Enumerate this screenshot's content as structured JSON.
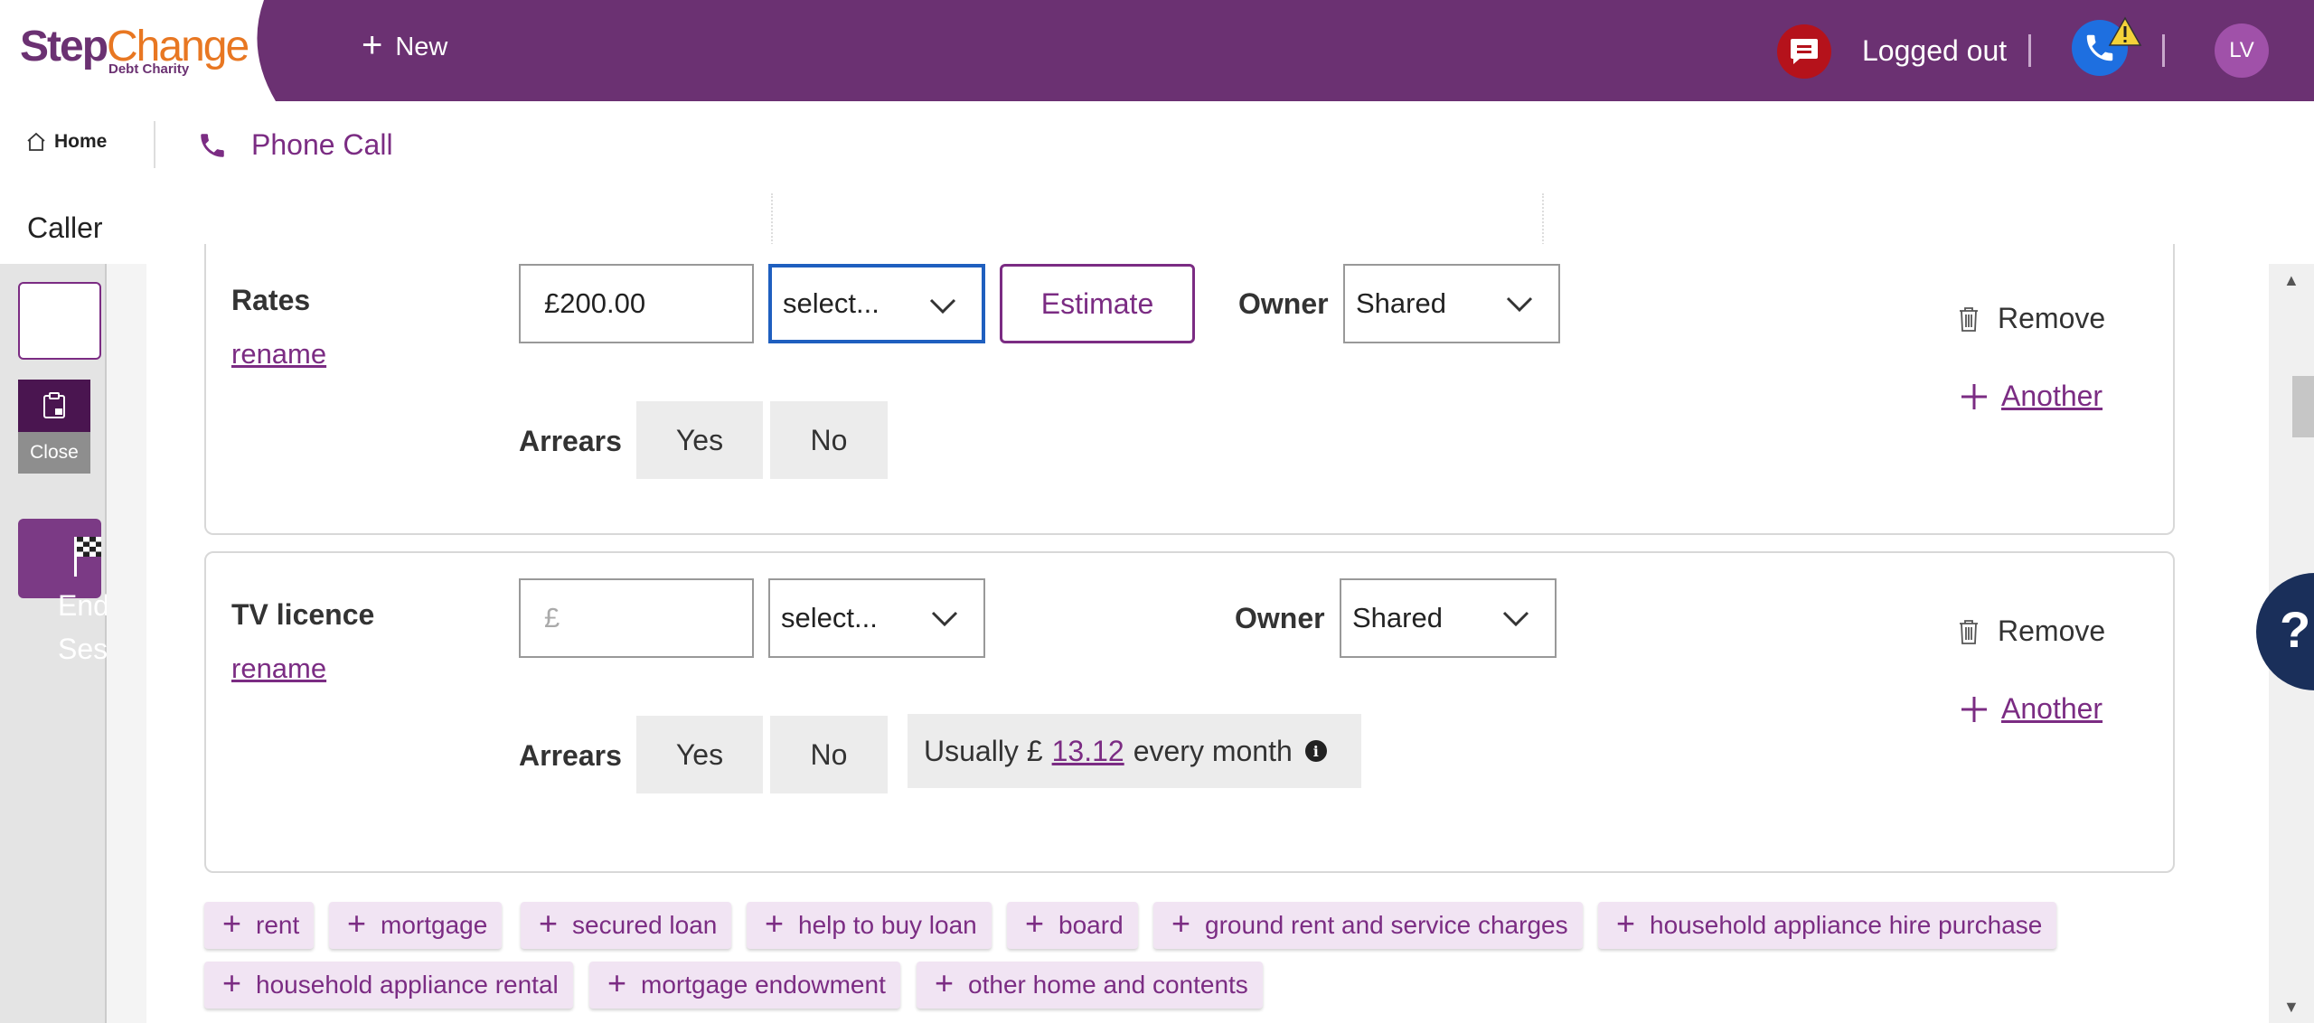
{
  "header": {
    "logo_step": "Step",
    "logo_change": "Change",
    "logo_sub": "Debt Charity",
    "new_label": "New",
    "status": "Logged out",
    "avatar_initials": "LV"
  },
  "nav": {
    "home": "Home",
    "phone_call": "Phone Call",
    "caller": "Caller"
  },
  "rail": {
    "close_label": "Close",
    "end_label": "End Ses"
  },
  "expenses": [
    {
      "name": "Rates",
      "rename": "rename",
      "amount_value": "£200.00",
      "frequency": "select...",
      "estimate_label": "Estimate",
      "owner_label": "Owner",
      "owner_value": "Shared",
      "arrears_label": "Arrears",
      "yes": "Yes",
      "no": "No",
      "remove": "Remove",
      "another": "Another"
    },
    {
      "name": "TV licence",
      "rename": "rename",
      "amount_placeholder": "£",
      "frequency": "select...",
      "owner_label": "Owner",
      "owner_value": "Shared",
      "arrears_label": "Arrears",
      "yes": "Yes",
      "no": "No",
      "remove": "Remove",
      "another": "Another",
      "usually_prefix": "Usually £",
      "usually_amount": "13.12",
      "usually_suffix": "every month"
    }
  ],
  "chips": [
    "rent",
    "mortgage",
    "secured loan",
    "help to buy loan",
    "board",
    "ground rent and service charges",
    "household appliance hire purchase",
    "household appliance rental",
    "mortgage endowment",
    "other home and contents"
  ],
  "help_label": "?",
  "colors": {
    "brand_purple": "#6b3172",
    "accent_purple": "#7b2c83",
    "brand_orange": "#e87722",
    "chip_bg": "#f1e4f3"
  }
}
